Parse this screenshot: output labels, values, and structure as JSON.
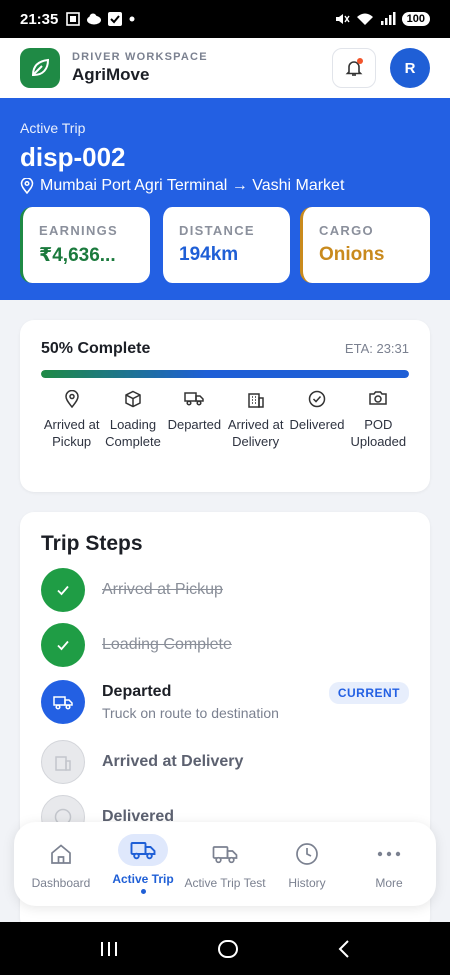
{
  "status_bar": {
    "time": "21:35",
    "battery": "100"
  },
  "header": {
    "subtitle": "DRIVER WORKSPACE",
    "app_name": "AgriMove",
    "avatar_initial": "R"
  },
  "hero": {
    "label": "Active Trip",
    "trip_id": "disp-002",
    "route": "Mumbai Port Agri Terminal → Vashi Market",
    "stats": [
      {
        "key": "EARNINGS",
        "value": "₹4,636..."
      },
      {
        "key": "DISTANCE",
        "value": "194km"
      },
      {
        "key": "CARGO",
        "value": "Onions"
      }
    ]
  },
  "progress": {
    "title": "50% Complete",
    "eta": "ETA: 23:31",
    "percent": 100,
    "milestones": [
      {
        "label": "Arrived at Pickup",
        "icon": "map-pin-icon"
      },
      {
        "label": "Loading Complete",
        "icon": "box-icon"
      },
      {
        "label": "Departed",
        "icon": "truck-icon"
      },
      {
        "label": "Arrived at Delivery",
        "icon": "building-icon"
      },
      {
        "label": "Delivered",
        "icon": "check-circle-icon"
      },
      {
        "label": "POD Uploaded",
        "icon": "camera-icon"
      }
    ]
  },
  "steps": {
    "title": "Trip Steps",
    "current_badge": "CURRENT",
    "items": [
      {
        "title": "Arrived at Pickup",
        "state": "done"
      },
      {
        "title": "Loading Complete",
        "state": "done"
      },
      {
        "title": "Departed",
        "desc": "Truck on route to destination",
        "state": "current"
      },
      {
        "title": "Arrived at Delivery",
        "state": "todo"
      },
      {
        "title": "Delivered",
        "state": "todo"
      }
    ]
  },
  "nav": {
    "items": [
      {
        "label": "Dashboard",
        "icon": "home-icon"
      },
      {
        "label": "Active Trip",
        "icon": "truck-icon"
      },
      {
        "label": "Active Trip Test",
        "icon": "truck-outline-icon"
      },
      {
        "label": "History",
        "icon": "clock-icon"
      },
      {
        "label": "More",
        "icon": "more-dots-icon"
      }
    ]
  },
  "colors": {
    "primary": "#2360e3",
    "success": "#1f9d45",
    "cargo": "#c98a1d"
  }
}
